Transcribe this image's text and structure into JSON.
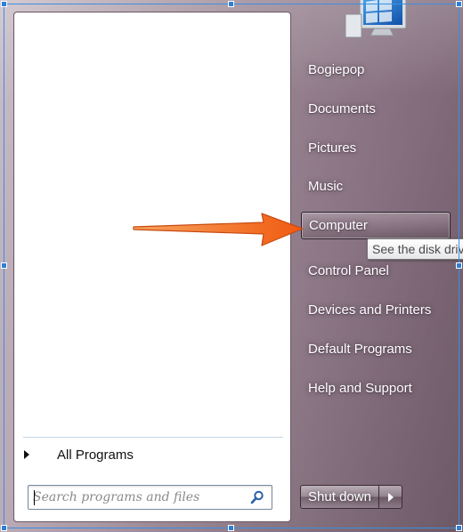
{
  "colors": {
    "accent_arrow": "#f26b1d",
    "selection_frame": "#2f7fd6",
    "menu_glass": "#9e8a97"
  },
  "left_pane": {
    "all_programs_label": "All Programs",
    "search_placeholder": "Search programs and files",
    "search_value": ""
  },
  "right_pane": {
    "user_picture_icon": "monitor-icon",
    "items": [
      {
        "label": "Bogiepop"
      },
      {
        "label": "Documents"
      },
      {
        "label": "Pictures"
      },
      {
        "label": "Music"
      },
      {
        "label": "Computer",
        "highlighted": true
      },
      {
        "label": "Control Panel"
      },
      {
        "label": "Devices and Printers"
      },
      {
        "label": "Default Programs"
      },
      {
        "label": "Help and Support"
      }
    ],
    "tooltip": "See the disk driv"
  },
  "shutdown": {
    "label": "Shut down",
    "options_icon": "chevron-right-icon"
  },
  "annotation": {
    "icon": "arrow-right-icon"
  }
}
